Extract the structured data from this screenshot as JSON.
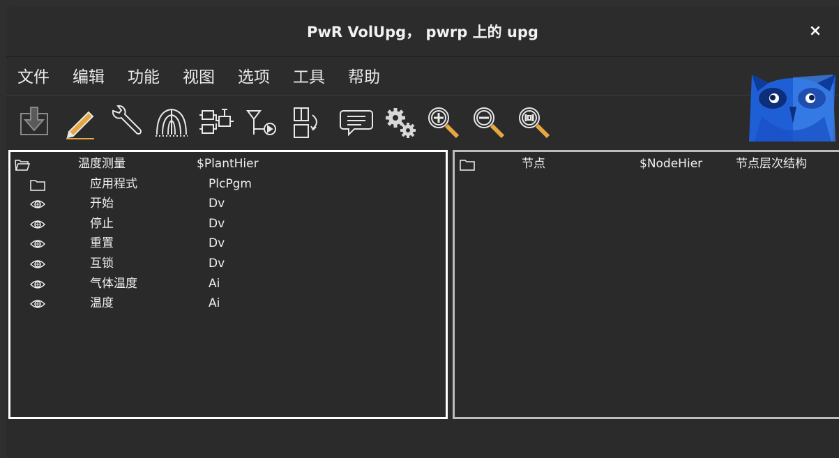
{
  "window": {
    "title": "PwR VolUpg，  pwrp 上的 upg",
    "close_glyph": "×"
  },
  "menu": [
    "文件",
    "编辑",
    "功能",
    "视图",
    "选项",
    "工具",
    "帮助"
  ],
  "toolbar": [
    "import-icon",
    "edit-pencil-icon",
    "wrench-icon",
    "hierarchy-tree-icon",
    "function-blocks-icon",
    "signal-valve-icon",
    "object-flow-icon",
    "comment-bubble-icon",
    "gears-icon",
    "zoom-in-icon",
    "zoom-out-icon",
    "zoom-reset-icon"
  ],
  "plant": {
    "header": {
      "icon": "open-folder-icon",
      "name": "温度测量",
      "class": "$PlantHier"
    },
    "items": [
      {
        "icon": "folder-icon",
        "name": "应用程式",
        "class": "PlcPgm"
      },
      {
        "icon": "signal-eye-icon",
        "name": "开始",
        "class": "Dv"
      },
      {
        "icon": "signal-eye-icon",
        "name": "停止",
        "class": "Dv"
      },
      {
        "icon": "signal-eye-icon",
        "name": "重置",
        "class": "Dv"
      },
      {
        "icon": "signal-eye-icon",
        "name": "互锁",
        "class": "Dv"
      },
      {
        "icon": "signal-eye-icon",
        "name": "气体温度",
        "class": "Ai"
      },
      {
        "icon": "signal-eye-icon",
        "name": "温度",
        "class": "Ai"
      }
    ]
  },
  "node": {
    "header": {
      "icon": "folder-icon",
      "name": "节点",
      "class": "$NodeHier",
      "description": "节点层次结构"
    }
  },
  "colors": {
    "background": "#2b2b2b",
    "text": "#e6e6e6",
    "selection_border": "#ffffff",
    "owl_blue": "#1f5fd6"
  }
}
